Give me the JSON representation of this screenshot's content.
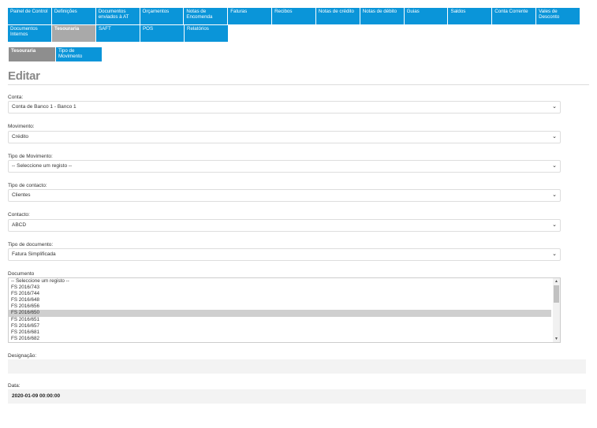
{
  "nav": {
    "row1": [
      {
        "label": "Painel de Control",
        "active": false
      },
      {
        "label": "Definições",
        "active": false
      },
      {
        "label": "Documentos enviados à AT",
        "active": false
      },
      {
        "label": "Orçamentos",
        "active": false
      },
      {
        "label": "Notas de Encomenda",
        "active": false
      },
      {
        "label": "Faturas",
        "active": false
      },
      {
        "label": "Recibos",
        "active": false
      },
      {
        "label": "Notas de crédito",
        "active": false
      },
      {
        "label": "Notas de débito",
        "active": false
      },
      {
        "label": "Guias",
        "active": false
      },
      {
        "label": "Saldos",
        "active": false
      },
      {
        "label": "Conta Corrente",
        "active": false
      },
      {
        "label": "Vales de Desconto",
        "active": false
      }
    ],
    "row2": [
      {
        "label": "Documentos Internos",
        "active": false
      },
      {
        "label": "Tesouraria",
        "active": true
      },
      {
        "label": "SAFT",
        "active": false
      },
      {
        "label": "POS",
        "active": false
      },
      {
        "label": "Relatórios",
        "active": false
      }
    ]
  },
  "subnav": {
    "active_label": "Tesouraria",
    "link_label": "Tipo de Movimento"
  },
  "page": {
    "title": "Editar"
  },
  "form": {
    "conta": {
      "label": "Conta:",
      "value": "Conta de Banco 1 - Banco 1"
    },
    "movimento": {
      "label": "Movimento:",
      "value": "Crédito"
    },
    "tipo_movimento": {
      "label": "Tipo de Movimento:",
      "value": "-- Seleccione um registo --"
    },
    "tipo_contacto": {
      "label": "Tipo de contacto:",
      "value": "Clientes"
    },
    "contacto": {
      "label": "Contacto:",
      "value": "ABCD"
    },
    "tipo_documento": {
      "label": "Tipo de documento:",
      "value": "Fatura Simplificada"
    },
    "documento": {
      "label": "Documento",
      "options": [
        "-- Seleccione um registo --",
        "FS 2016/743",
        "FS 2016/744",
        "FS 2016/648",
        "FS 2016/656",
        "FS 2016/650",
        "FS 2016/651",
        "FS 2016/657",
        "FS 2016/681",
        "FS 2016/682"
      ],
      "selected_index": 5
    },
    "designacao": {
      "label": "Designação:",
      "value": ""
    },
    "data": {
      "label": "Data:",
      "value": "2020-01-09 00:00:00"
    }
  }
}
